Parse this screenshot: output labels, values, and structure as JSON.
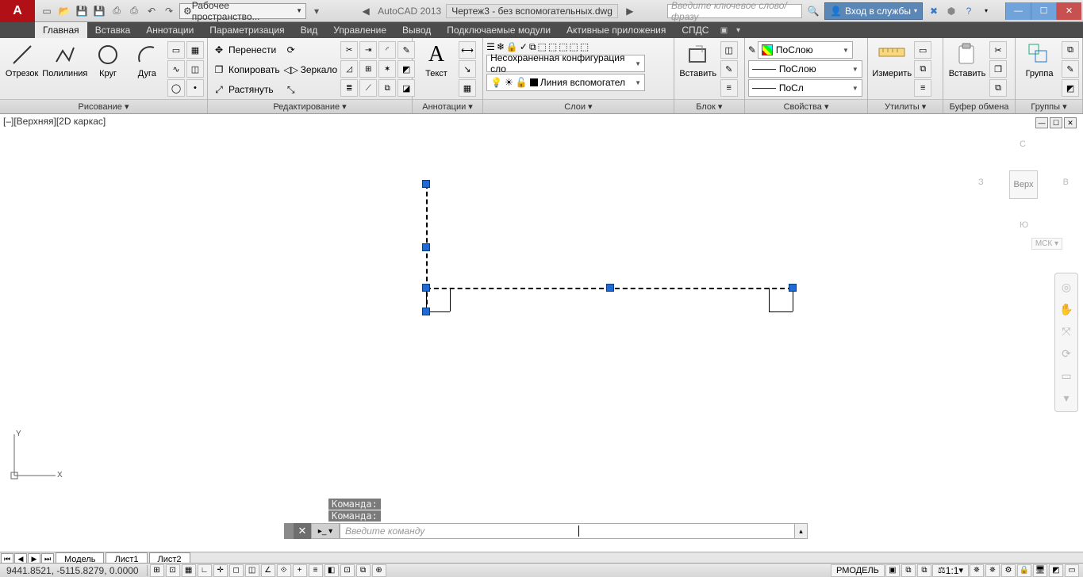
{
  "title": {
    "app": "AutoCAD 2013",
    "doc": "Чертеж3 - без вспомогательных.dwg"
  },
  "search": {
    "ph": "Введите ключевое слово/фразу"
  },
  "services": {
    "login": "Вход в службы"
  },
  "workspace": {
    "label": "Рабочее пространство..."
  },
  "tabs": [
    "Главная",
    "Вставка",
    "Аннотации",
    "Параметризация",
    "Вид",
    "Управление",
    "Вывод",
    "Подключаемые модули",
    "Активные приложения",
    "СПДС"
  ],
  "panels": {
    "draw": {
      "title": "Рисование ▾",
      "btns": [
        "Отрезок",
        "Полилиния",
        "Круг",
        "Дуга"
      ]
    },
    "edit": {
      "title": "Редактирование ▾",
      "rows": [
        "Перенести",
        "Копировать",
        "Растянуть",
        "Зеркало"
      ]
    },
    "annot": {
      "title": "Аннотации ▾",
      "btn": "Текст"
    },
    "layers": {
      "title": "Слои ▾",
      "combo1": "Несохраненная конфигурация сло",
      "combo2": "Линия вспомогател"
    },
    "block": {
      "title": "Блок ▾",
      "btn": "Вставить"
    },
    "props": {
      "title": "Свойства ▾",
      "c1": "ПоСлою",
      "c2": "ПоСлою",
      "c3": "ПоСл"
    },
    "util": {
      "title": "Утилиты ▾",
      "btn": "Измерить"
    },
    "clip": {
      "title": "Буфер обмена",
      "btn": "Вставить"
    },
    "group": {
      "title": "Группы ▾",
      "btn": "Группа"
    }
  },
  "viewport": {
    "label": "[–][Верхняя][2D каркас]"
  },
  "viewcube": {
    "top": "Верх",
    "n": "С",
    "s": "Ю",
    "e": "В",
    "w": "З",
    "wcs": "МСК ▾"
  },
  "cmd": {
    "hist1": "Команда:",
    "hist2": "Команда:",
    "ph": "Введите команду"
  },
  "ltabs": {
    "model": "Модель",
    "l1": "Лист1",
    "l2": "Лист2"
  },
  "status": {
    "coords": "9441.8521, -5115.8279, 0.0000",
    "rmod": "РМОДЕЛЬ",
    "scale": "1:1"
  }
}
